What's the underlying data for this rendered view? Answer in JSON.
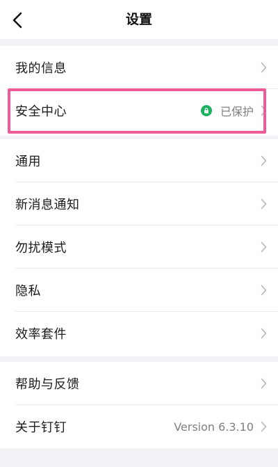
{
  "header": {
    "title": "设置",
    "back_icon": "chevron-left-icon"
  },
  "groups": [
    {
      "items": [
        {
          "label": "我的信息",
          "value": "",
          "icon": "chevron-right-icon"
        },
        {
          "label": "安全中心",
          "value": "已保护",
          "status_icon": "lock-icon",
          "status_color": "#1ab25f",
          "highlighted": true,
          "highlight_color": "#ee5b97"
        }
      ]
    },
    {
      "items": [
        {
          "label": "通用",
          "value": ""
        },
        {
          "label": "新消息通知",
          "value": ""
        },
        {
          "label": "勿扰模式",
          "value": ""
        },
        {
          "label": "隐私",
          "value": ""
        },
        {
          "label": "效率套件",
          "value": ""
        }
      ]
    },
    {
      "items": [
        {
          "label": "帮助与反馈",
          "value": ""
        },
        {
          "label": "关于钉钉",
          "value": "Version 6.3.10"
        }
      ]
    }
  ]
}
